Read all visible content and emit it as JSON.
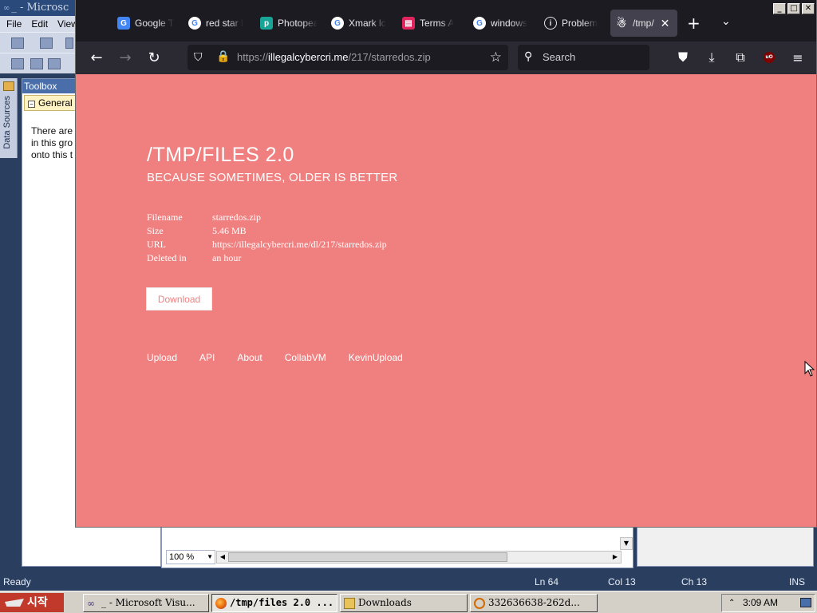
{
  "vs": {
    "title": "_ - Microsc",
    "menu": [
      "File",
      "Edit",
      "View"
    ],
    "side_tab": "Data Sources",
    "toolbox_title": "Toolbox",
    "toolbox_group": "General",
    "toolbox_note": "There are\n in this gro\nonto this t",
    "zoom": "100 %",
    "status": {
      "ready": "Ready",
      "ln": "Ln 64",
      "col": "Col 13",
      "ch": "Ch 13",
      "ins": "INS"
    }
  },
  "browser": {
    "tabs": [
      {
        "title": "Google T",
        "icon": "google-translate-icon"
      },
      {
        "title": "red star l",
        "icon": "google-icon"
      },
      {
        "title": "Photopea",
        "icon": "photopea-icon"
      },
      {
        "title": "Xmark lc",
        "icon": "google-icon"
      },
      {
        "title": "Terms A",
        "icon": "terms-icon"
      },
      {
        "title": "windows",
        "icon": "google-icon"
      },
      {
        "title": "Problem",
        "icon": "info-icon"
      },
      {
        "title": "/tmp/",
        "icon": "tmp-icon",
        "active": true
      }
    ],
    "url_prefix": "https://",
    "url_domain": "illegalcybercri.me",
    "url_path": "/217/starredos.zip",
    "search_placeholder": "Search",
    "ublock_label": "uO"
  },
  "page": {
    "title": "/TMP/FILES 2.0",
    "subtitle": "BECAUSE SOMETIMES, OLDER IS BETTER",
    "info": [
      {
        "key": "Filename",
        "value": "starredos.zip"
      },
      {
        "key": "Size",
        "value": "5.46 MB"
      },
      {
        "key": "URL",
        "value": "https://illegalcybercri.me/dl/217/starredos.zip"
      },
      {
        "key": "Deleted in",
        "value": "an hour"
      }
    ],
    "download_label": "Download",
    "footer_links": [
      "Upload",
      "API",
      "About",
      "CollabVM",
      "KevinUpload"
    ],
    "bg_color": "#f08080"
  },
  "taskbar": {
    "start_label": "시작",
    "tasks": [
      {
        "label": "_ - Microsoft Visu...",
        "icon": "visual-studio-icon"
      },
      {
        "label": "/tmp/files 2.0 ...",
        "icon": "firefox-icon",
        "active": true
      },
      {
        "label": "Downloads",
        "icon": "folder-icon"
      },
      {
        "label": "332636638-262d...",
        "icon": "image-viewer-icon"
      }
    ],
    "clock": "3:09 AM"
  }
}
